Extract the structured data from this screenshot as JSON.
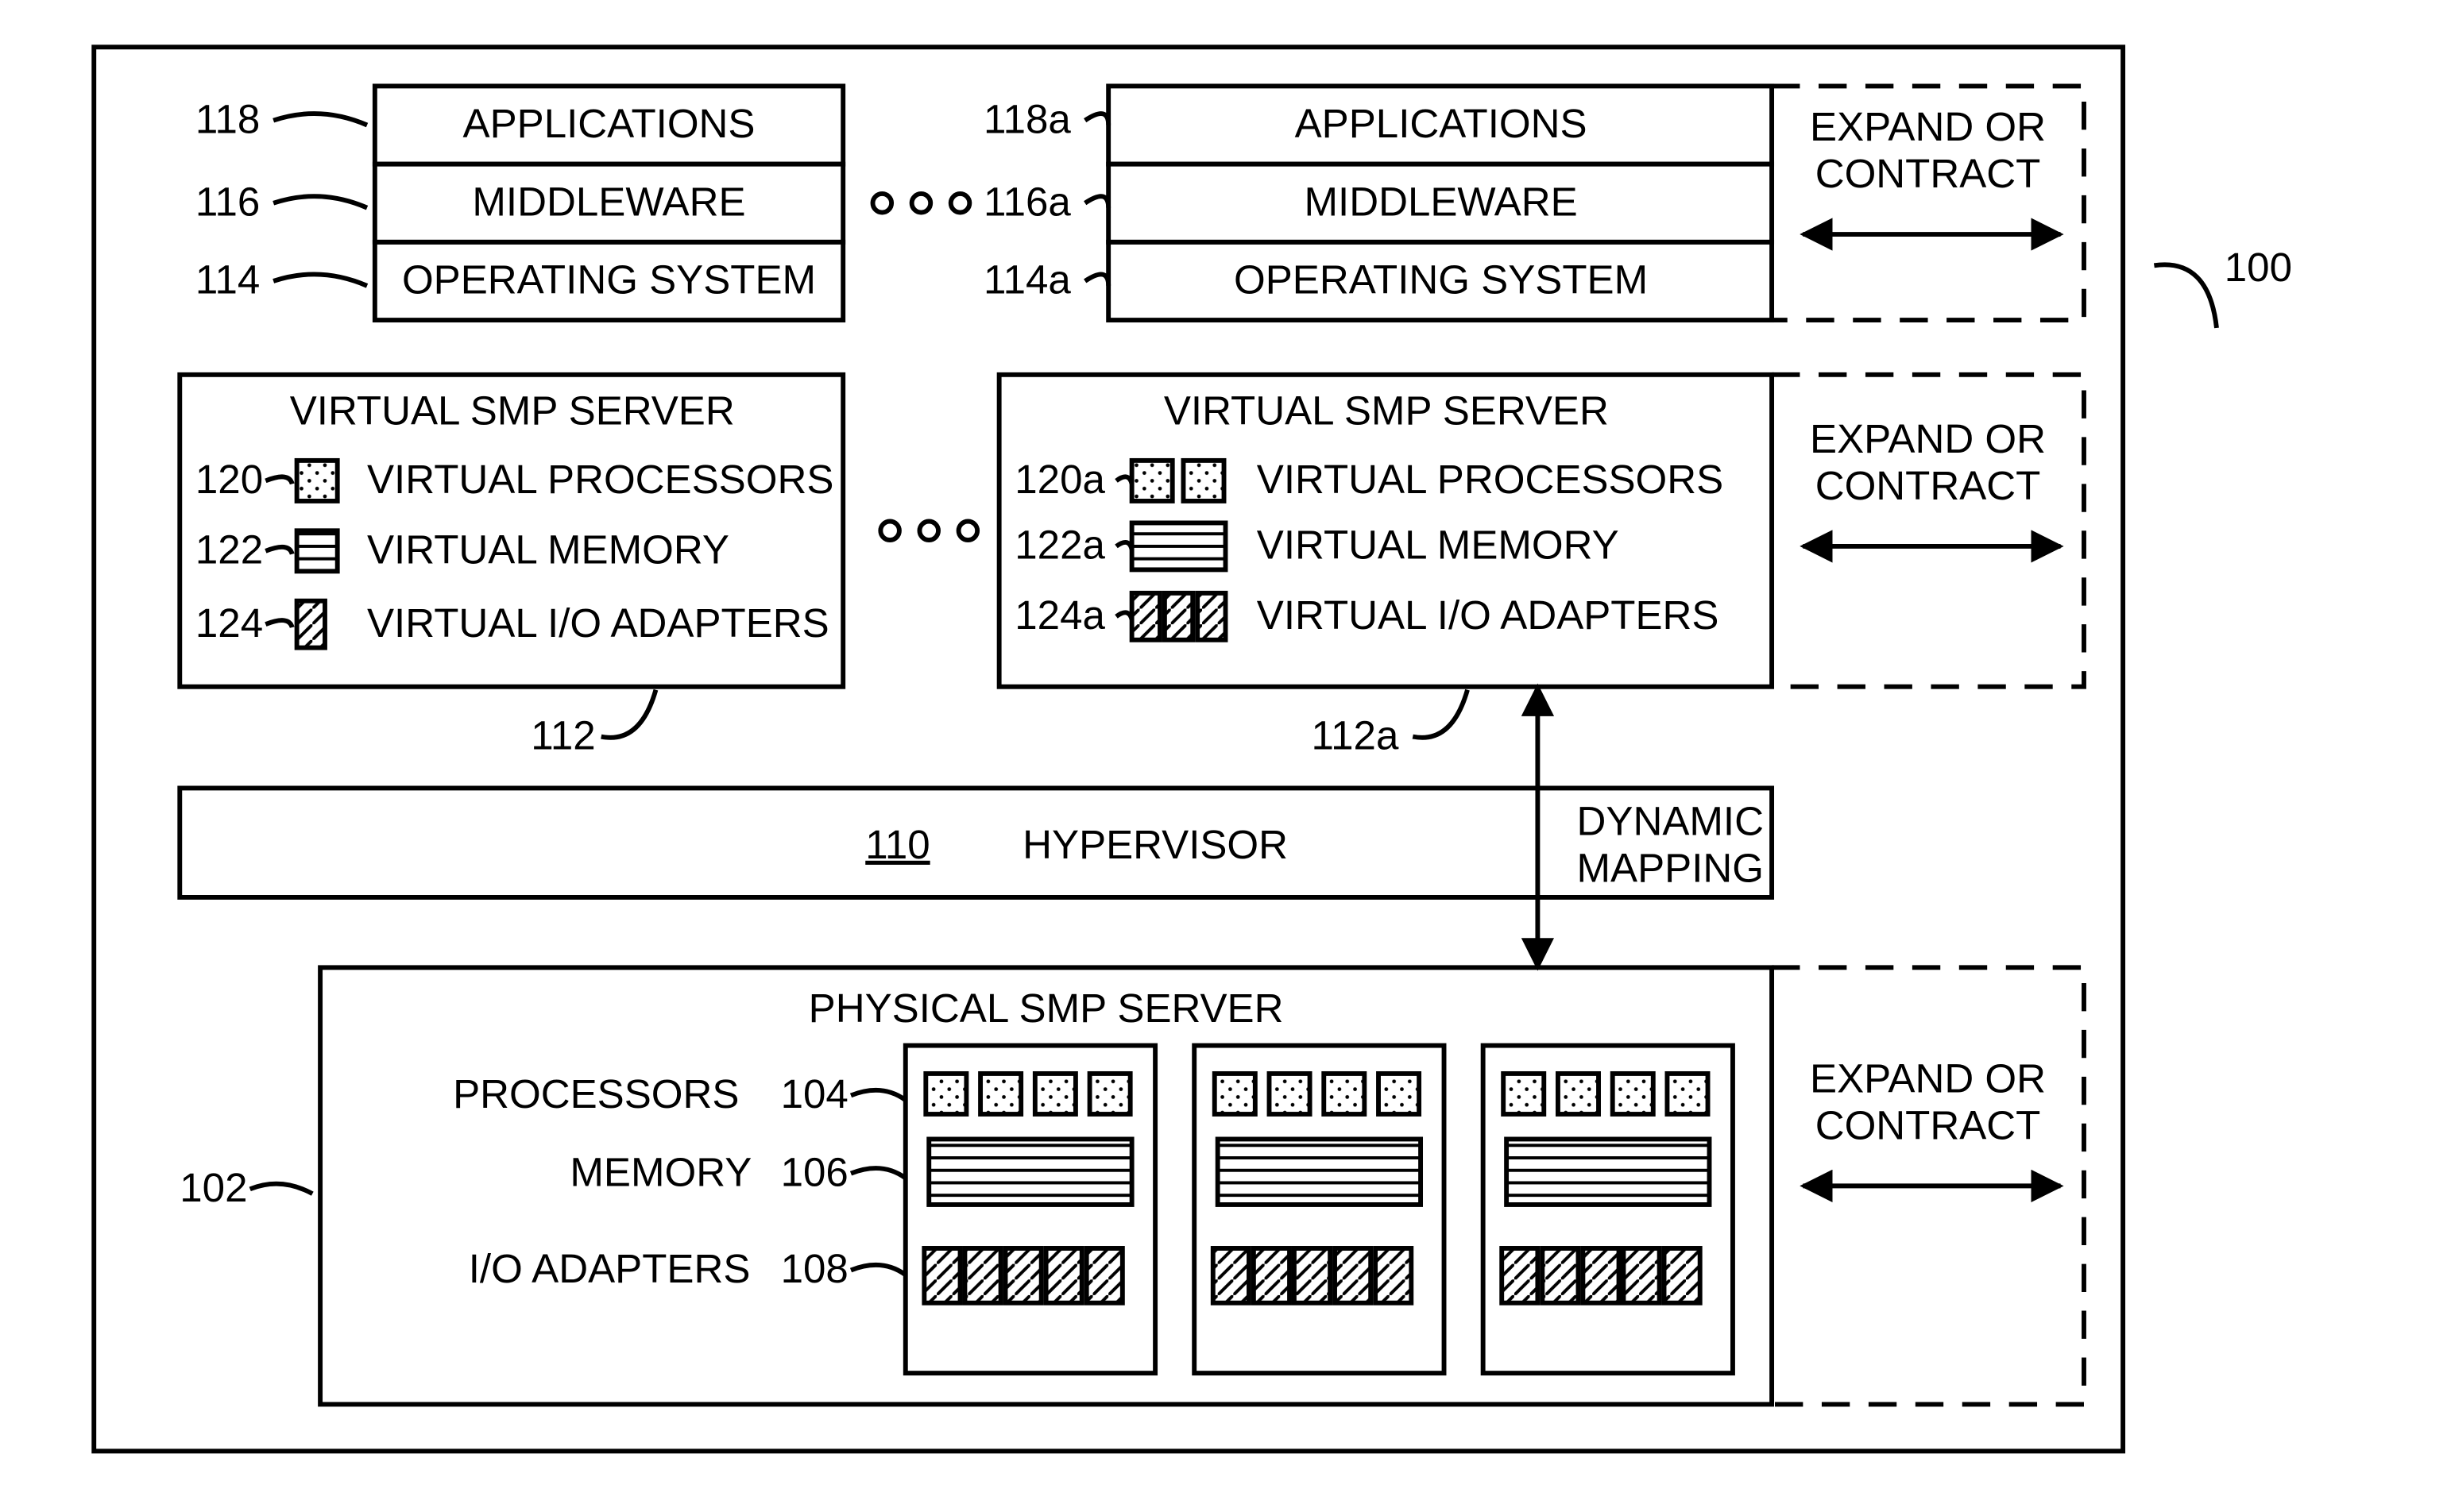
{
  "refs": {
    "r100": "100",
    "r102": "102",
    "r110": "110",
    "r112": "112",
    "r112a": "112a",
    "r114": "114",
    "r114a": "114a",
    "r116": "116",
    "r116a": "116a",
    "r118": "118",
    "r118a": "118a",
    "r120": "120",
    "r120a": "120a",
    "r122": "122",
    "r122a": "122a",
    "r124": "124",
    "r124a": "124a",
    "r104": "104",
    "r106": "106",
    "r108": "108"
  },
  "labels": {
    "applications": "APPLICATIONS",
    "middleware": "MIDDLEWARE",
    "os": "OPERATING SYSTEM",
    "vsmp": "VIRTUAL SMP SERVER",
    "vproc": "VIRTUAL PROCESSORS",
    "vmem": "VIRTUAL MEMORY",
    "vio": "VIRTUAL I/O ADAPTERS",
    "hyp": "HYPERVISOR",
    "dynmap1": "DYNAMIC",
    "dynmap2": "MAPPING",
    "psmp": "PHYSICAL SMP SERVER",
    "proc": "PROCESSORS",
    "mem": "MEMORY",
    "io": "I/O ADAPTERS",
    "exp1": "EXPAND OR",
    "exp2": "CONTRACT"
  }
}
